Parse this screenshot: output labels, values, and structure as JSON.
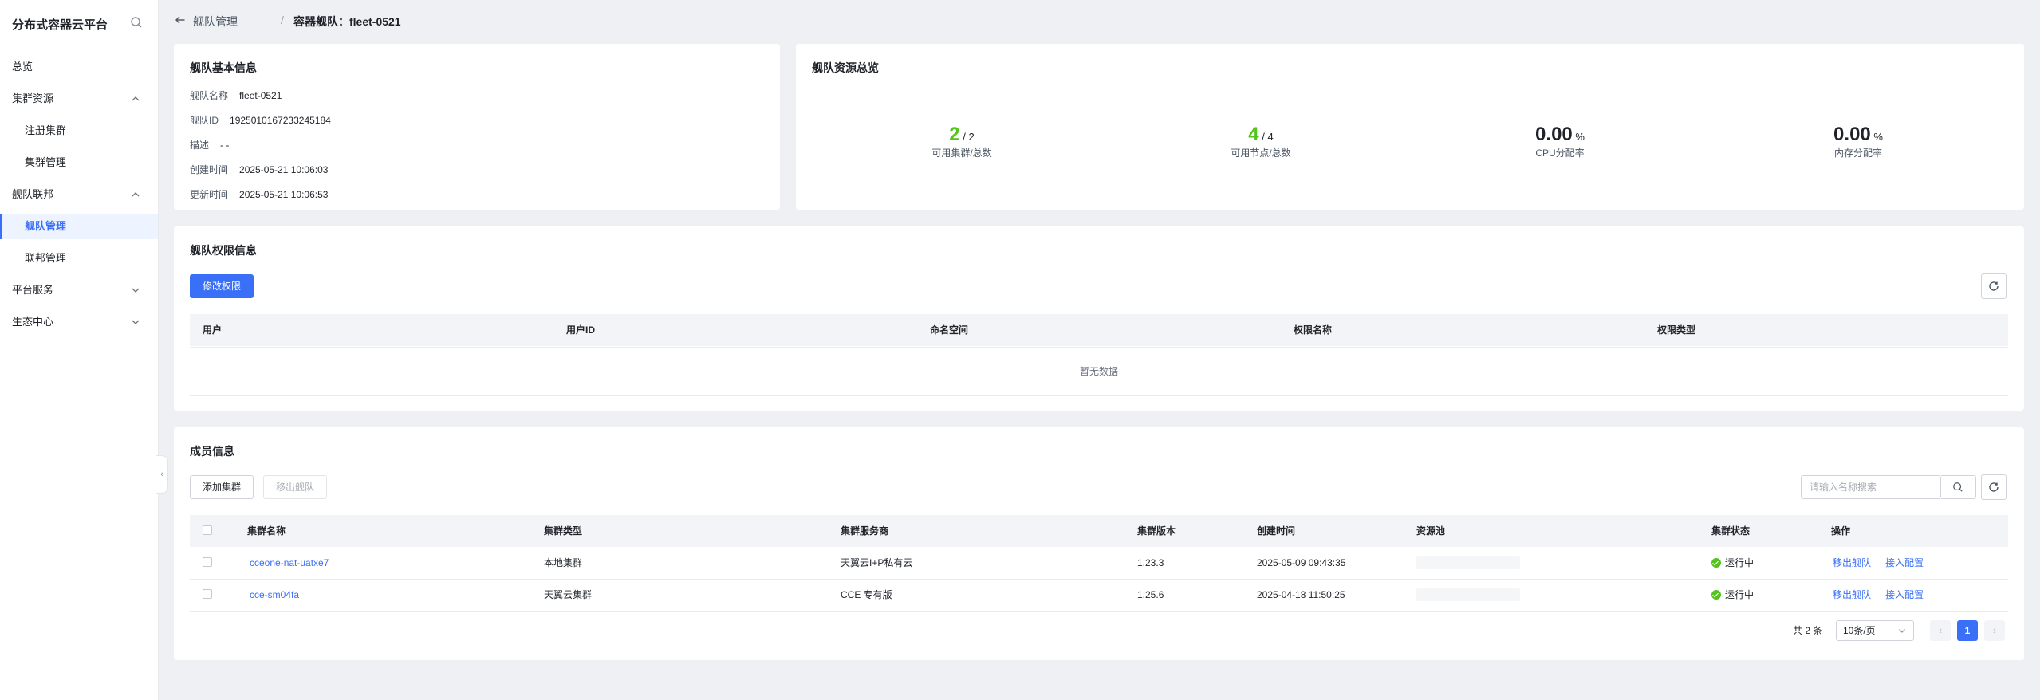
{
  "sidebar": {
    "brand": "分布式容器云平台",
    "items": [
      {
        "label": "总览"
      },
      {
        "label": "集群资源"
      },
      {
        "label": "注册集群"
      },
      {
        "label": "集群管理"
      },
      {
        "label": "舰队联邦"
      },
      {
        "label": "舰队管理"
      },
      {
        "label": "联邦管理"
      },
      {
        "label": "平台服务"
      },
      {
        "label": "生态中心"
      }
    ]
  },
  "header": {
    "parent": "舰队管理",
    "separator": "/",
    "current": "容器舰队：fleet-0521"
  },
  "basic_info": {
    "title": "舰队基本信息",
    "rows": [
      {
        "label": "舰队名称",
        "value": "fleet-0521"
      },
      {
        "label": "舰队ID",
        "value": "1925010167233245184"
      },
      {
        "label": "描述",
        "value": "- -"
      },
      {
        "label": "创建时间",
        "value": "2025-05-21 10:06:03"
      },
      {
        "label": "更新时间",
        "value": "2025-05-21 10:06:53"
      }
    ]
  },
  "resources": {
    "title": "舰队资源总览",
    "stats": [
      {
        "value": "2",
        "suffix": "/ 2",
        "caption": "可用集群/总数",
        "color": "#52c41a"
      },
      {
        "value": "4",
        "suffix": "/ 4",
        "caption": "可用节点/总数",
        "color": "#52c41a"
      },
      {
        "value": "0.00",
        "suffix": "%",
        "caption": "CPU分配率",
        "color": "#1f2329"
      },
      {
        "value": "0.00",
        "suffix": "%",
        "caption": "内存分配率",
        "color": "#1f2329"
      }
    ]
  },
  "permissions": {
    "title": "舰队权限信息",
    "edit_button": "修改权限",
    "columns": [
      "用户",
      "用户ID",
      "命名空间",
      "权限名称",
      "权限类型"
    ],
    "empty_text": "暂无数据"
  },
  "members": {
    "title": "成员信息",
    "add_button": "添加集群",
    "remove_button": "移出舰队",
    "search_placeholder": "请输入名称搜索",
    "columns": [
      "集群名称",
      "集群类型",
      "集群服务商",
      "集群版本",
      "创建时间",
      "资源池",
      "集群状态",
      "操作"
    ],
    "rows": [
      {
        "name": "cceone-nat-uatxe7",
        "type": "本地集群",
        "provider": "天翼云I+P私有云",
        "version": "1.23.3",
        "created": "2025-05-09 09:43:35",
        "status": "运行中",
        "action1": "移出舰队",
        "action2": "接入配置"
      },
      {
        "name": "cce-sm04fa",
        "type": "天翼云集群",
        "provider": "CCE 专有版",
        "version": "1.25.6",
        "created": "2025-04-18 11:50:25",
        "status": "运行中",
        "action1": "移出舰队",
        "action2": "接入配置"
      }
    ],
    "pagination": {
      "total_text": "共 2 条",
      "page_size": "10条/页",
      "current_page": "1"
    }
  },
  "colors": {
    "accent": "#3a6ff7",
    "success": "#52c41a"
  }
}
